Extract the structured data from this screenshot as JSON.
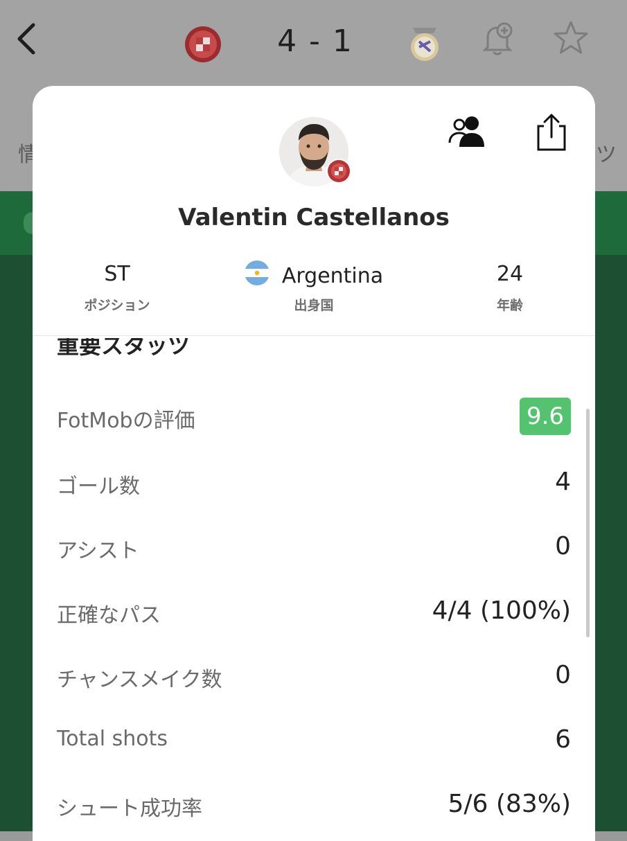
{
  "header": {
    "score": "4 - 1",
    "home_team": "Girona",
    "away_team": "Real Madrid",
    "tab_left_fragment": "情",
    "tab_right_fragment": "ツ"
  },
  "player": {
    "name": "Valentin Castellanos",
    "position": {
      "value": "ST",
      "label": "ポジション"
    },
    "country": {
      "value": "Argentina",
      "label": "出身国"
    },
    "age": {
      "value": "24",
      "label": "年齢"
    }
  },
  "stats": {
    "section_title": "重要スタッツ",
    "rating": {
      "label": "FotMobの評価",
      "value": "9.6"
    },
    "goals": {
      "label": "ゴール数",
      "value": "4"
    },
    "assists": {
      "label": "アシスト",
      "value": "0"
    },
    "accurate_passes": {
      "label": "正確なパス",
      "value": "4/4 (100%)"
    },
    "chances_created": {
      "label": "チャンスメイク数",
      "value": "0"
    },
    "total_shots": {
      "label": "Total shots",
      "value": "6"
    },
    "shot_accuracy": {
      "label": "シュート成功率",
      "value": "5/6 (83%)"
    }
  },
  "colors": {
    "rating_badge": "#53c36f",
    "background_green": "#1d4f32",
    "header_gray": "#a3a3a3"
  },
  "icons": [
    "back-chevron-icon",
    "girona-crest-icon",
    "real-madrid-crest-icon",
    "bell-add-icon",
    "star-icon",
    "person-group-icon",
    "share-icon",
    "argentina-flag-icon"
  ]
}
